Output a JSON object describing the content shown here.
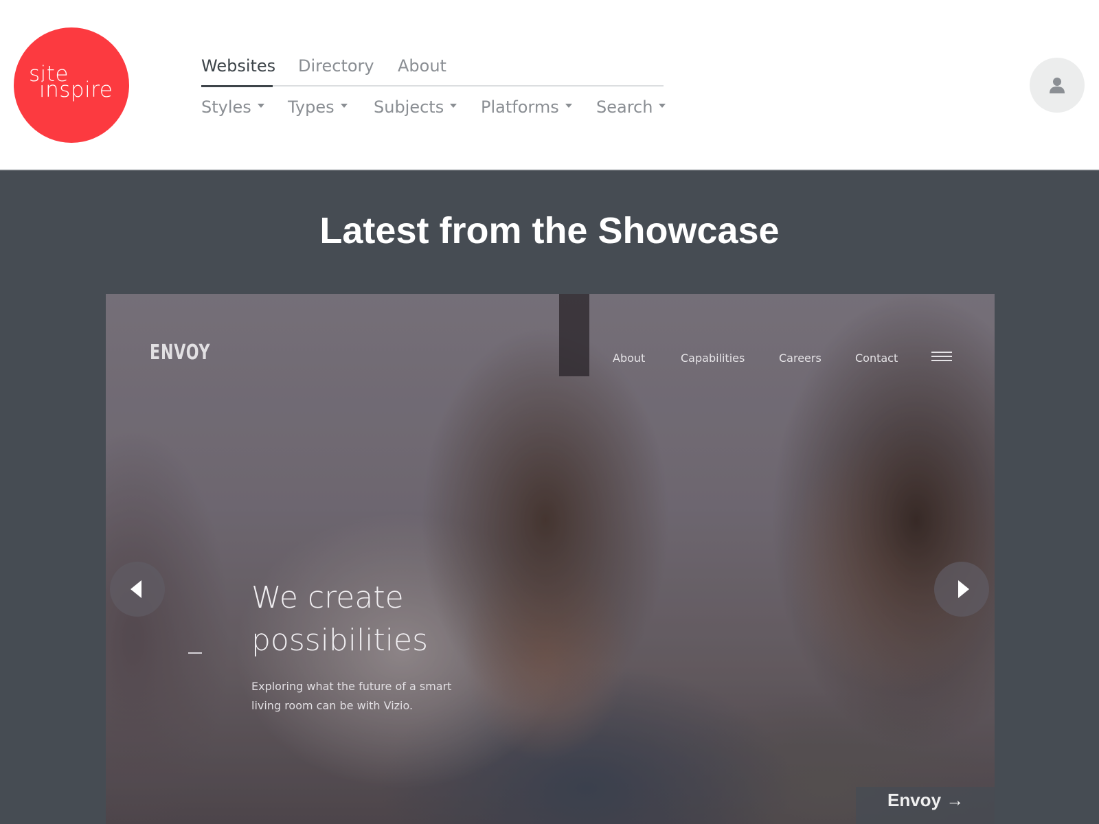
{
  "logo": {
    "line1": "site",
    "line2": "inspire",
    "color": "#fc3a40"
  },
  "nav": {
    "tabs": [
      {
        "label": "Websites",
        "active": true
      },
      {
        "label": "Directory",
        "active": false
      },
      {
        "label": "About",
        "active": false
      }
    ],
    "filters": [
      {
        "label": "Styles"
      },
      {
        "label": "Types"
      },
      {
        "label": "Subjects"
      },
      {
        "label": "Platforms"
      },
      {
        "label": "Search"
      }
    ]
  },
  "account": {
    "icon": "user-icon"
  },
  "showcase": {
    "title": "Latest from the Showcase",
    "background": "#464c53",
    "slide": {
      "site_logo": "ENVOY",
      "site_nav": [
        "About",
        "Capabilities",
        "Careers",
        "Contact"
      ],
      "menu_icon": "hamburger-icon",
      "heading_line1": "We create",
      "heading_line2": "possibilities",
      "subtext_line1": "Exploring what the future of a smart",
      "subtext_line2": "living room can be with Vizio."
    },
    "prev_icon": "chevron-left-icon",
    "next_icon": "chevron-right-icon",
    "caption": "Envoy →"
  }
}
